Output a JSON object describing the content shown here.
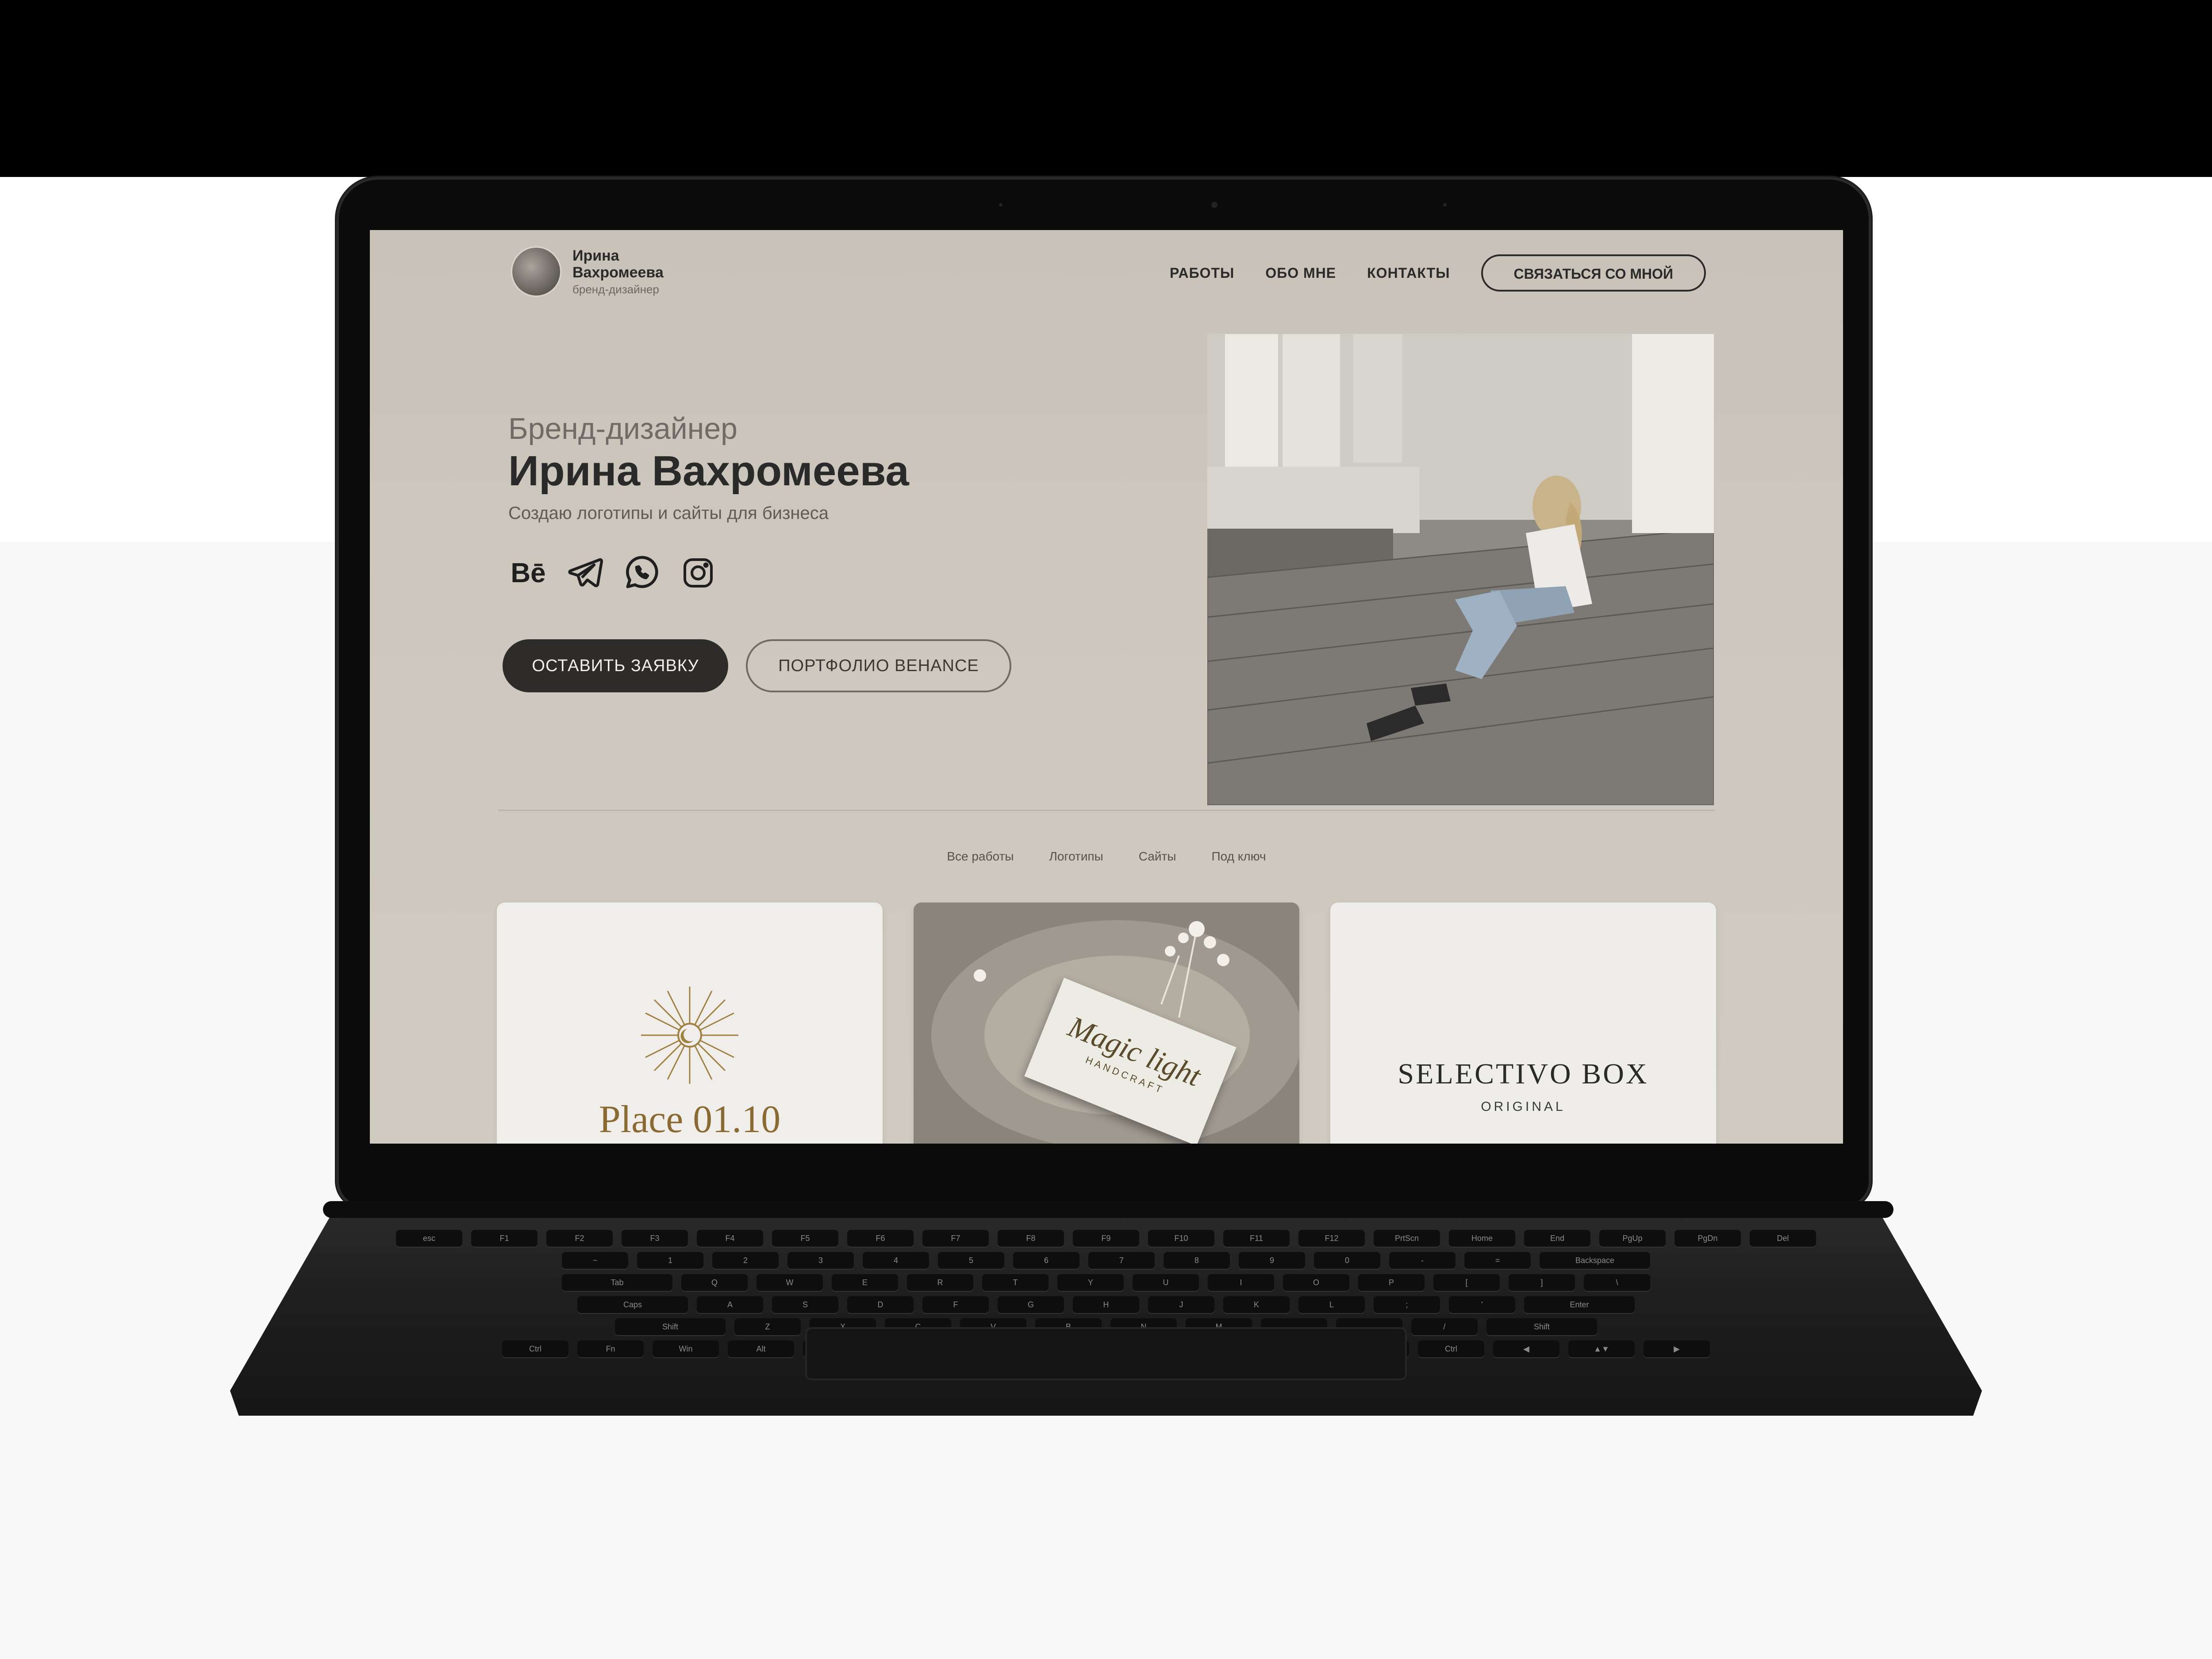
{
  "site": {
    "logo": {
      "name": "Ирина Вахромеева",
      "role": "бренд-дизайнер"
    },
    "nav": {
      "items": [
        "РАБОТЫ",
        "ОБО МНЕ",
        "КОНТАКТЫ"
      ],
      "cta": "СВЯЗАТЬСЯ СО МНОЙ"
    },
    "hero": {
      "subtitle": "Бренд-дизайнер",
      "title": "Ирина Вахромеева",
      "description": "Создаю логотипы и сайты для бизнеса",
      "socials": [
        "behance-icon",
        "telegram-icon",
        "whatsapp-icon",
        "instagram-icon"
      ],
      "behance_label": "Bē",
      "primary_button": "ОСТАВИТЬ ЗАЯВКУ",
      "secondary_button": "ПОРТФОЛИО BEHANCE"
    },
    "filters": [
      "Все работы",
      "Логотипы",
      "Сайты",
      "Под ключ"
    ],
    "cards": [
      {
        "title": "Place 01.10",
        "icon": "sun-icon"
      },
      {
        "title": "Magic light",
        "subtitle": "HANDCRAFT"
      },
      {
        "title": "SELECTIVO BOX",
        "subtitle": "ORIGINAL"
      }
    ]
  },
  "colors": {
    "site_background": "#cdc7bd",
    "text_dark": "#2a2a2a",
    "accent_gold": "#8b6a32",
    "button_dark": "#2d2c2b"
  },
  "keyboard": {
    "row1": [
      "esc",
      "F1",
      "F2",
      "F3",
      "F4",
      "F5",
      "F6",
      "F7",
      "F8",
      "F9",
      "F10",
      "F11",
      "F12",
      "PrtScn",
      "Home",
      "End",
      "PgUp",
      "PgDn",
      "Del"
    ],
    "row2": [
      "~",
      "1",
      "2",
      "3",
      "4",
      "5",
      "6",
      "7",
      "8",
      "9",
      "0",
      "-",
      "=",
      "Backspace"
    ],
    "row3": [
      "Tab",
      "Q",
      "W",
      "E",
      "R",
      "T",
      "Y",
      "U",
      "I",
      "O",
      "P",
      "[",
      "]",
      "\\"
    ],
    "row4": [
      "Caps",
      "A",
      "S",
      "D",
      "F",
      "G",
      "H",
      "J",
      "K",
      "L",
      ";",
      "'",
      "Enter"
    ],
    "row5": [
      "Shift",
      "Z",
      "X",
      "C",
      "V",
      "B",
      "N",
      "M",
      ",",
      ".",
      "/",
      "Shift"
    ],
    "row6": [
      "Ctrl",
      "Fn",
      "Win",
      "Alt",
      "",
      "Alt",
      "Ctrl",
      "◀",
      "▲▼",
      "▶"
    ]
  }
}
